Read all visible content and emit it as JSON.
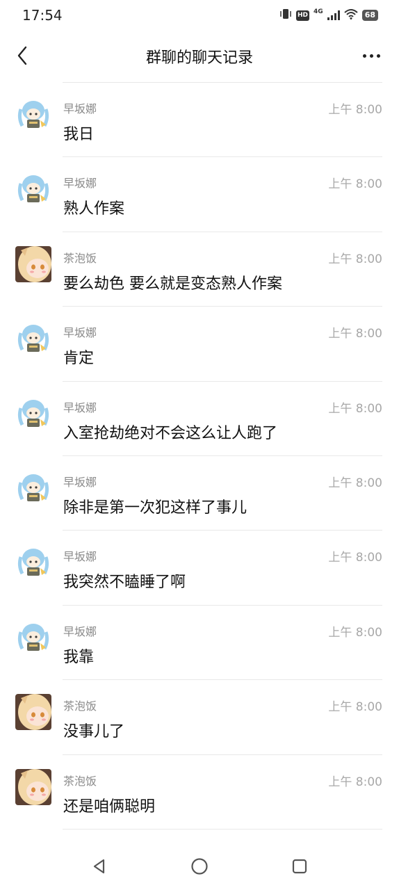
{
  "status_bar": {
    "time": "17:54",
    "hd_badge": "HD",
    "network": "4G",
    "battery": "68",
    "icons": [
      "vibrate-icon",
      "hd-icon",
      "signal-icon",
      "wifi-icon",
      "battery-icon"
    ]
  },
  "header": {
    "title": "群聊的聊天记录",
    "back_icon": "chevron-left-icon",
    "more_icon": "more-dots-icon"
  },
  "colors": {
    "hayasaka_avatar": "#9ed0ee",
    "chapaofan_avatar": "#f3d8a8",
    "divider": "#e8e8e8",
    "sender_text": "#8a8a8a",
    "time_text": "#a8a8a8"
  },
  "messages": [
    {
      "sender": "早坂娜",
      "time": "上午 8:00",
      "text": "我日",
      "avatar": "hayasaka"
    },
    {
      "sender": "早坂娜",
      "time": "上午 8:00",
      "text": "熟人作案",
      "avatar": "hayasaka"
    },
    {
      "sender": "茶泡饭",
      "time": "上午 8:00",
      "text": "要么劫色 要么就是变态熟人作案",
      "avatar": "chapaofan"
    },
    {
      "sender": "早坂娜",
      "time": "上午 8:00",
      "text": "肯定",
      "avatar": "hayasaka"
    },
    {
      "sender": "早坂娜",
      "time": "上午 8:00",
      "text": "入室抢劫绝对不会这么让人跑了",
      "avatar": "hayasaka"
    },
    {
      "sender": "早坂娜",
      "time": "上午 8:00",
      "text": "除非是第一次犯这样了事儿",
      "avatar": "hayasaka"
    },
    {
      "sender": "早坂娜",
      "time": "上午 8:00",
      "text": "我突然不瞌睡了啊",
      "avatar": "hayasaka"
    },
    {
      "sender": "早坂娜",
      "time": "上午 8:00",
      "text": "我靠",
      "avatar": "hayasaka"
    },
    {
      "sender": "茶泡饭",
      "time": "上午 8:00",
      "text": "没事儿了",
      "avatar": "chapaofan"
    },
    {
      "sender": "茶泡饭",
      "time": "上午 8:00",
      "text": "还是咱俩聪明",
      "avatar": "chapaofan"
    }
  ],
  "system_nav": {
    "back": "triangle-back-icon",
    "home": "circle-home-icon",
    "recents": "square-recents-icon"
  }
}
